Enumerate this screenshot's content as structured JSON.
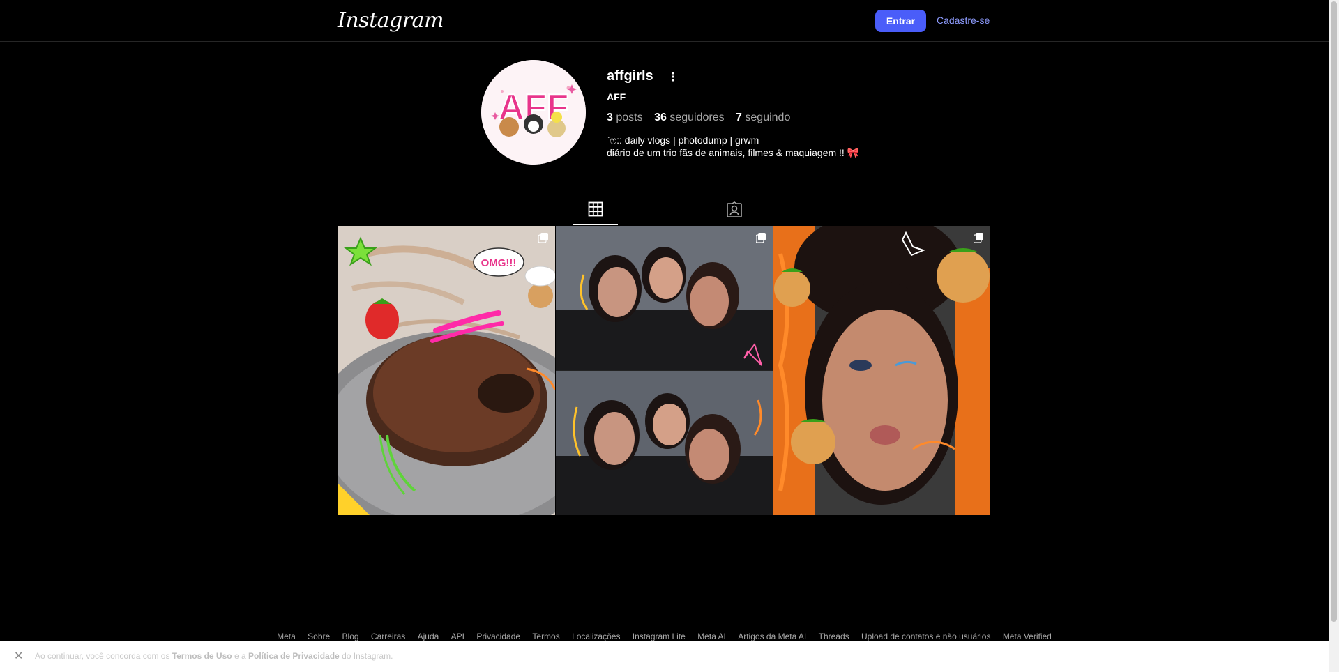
{
  "header": {
    "logo": "Instagram",
    "login_label": "Entrar",
    "signup_label": "Cadastre-se"
  },
  "profile": {
    "username": "affgirls",
    "full_name": "AFF",
    "avatar_text": "AFF",
    "stats": {
      "posts_count": "3",
      "posts_label": "posts",
      "followers_count": "36",
      "followers_label": "seguidores",
      "following_count": "7",
      "following_label": "seguindo"
    },
    "bio_line1": "`ෆ:: daily vlogs | photodump | grwm",
    "bio_line2": "diário de um trio fãs de animais, filmes & maquiagem !! 🎀"
  },
  "tabs": [
    {
      "icon": "grid-icon",
      "active": true
    },
    {
      "icon": "tagged-icon",
      "active": false
    }
  ],
  "posts": [
    {
      "subject": "chocolate cake",
      "sticker_text": "OMG!!!",
      "multi": true
    },
    {
      "subject": "three friends selfie",
      "multi": true
    },
    {
      "subject": "selfie with cats",
      "multi": true
    }
  ],
  "footer": {
    "links": [
      "Meta",
      "Sobre",
      "Blog",
      "Carreiras",
      "Ajuda",
      "API",
      "Privacidade",
      "Termos",
      "Localizações",
      "Instagram Lite",
      "Meta AI",
      "Artigos da Meta AI",
      "Threads",
      "Upload de contatos e não usuários",
      "Meta Verified"
    ]
  },
  "cookie": {
    "text_prefix": "Ao continuar, você concorda com os",
    "terms": "Termos de Uso",
    "and": "e a",
    "privacy": "Política de Privacidade",
    "suffix": "do Instagram."
  },
  "colors": {
    "background": "#000000",
    "primary_button": "#4a5df9",
    "link": "#8e9cff",
    "muted_text": "#a8a8a8"
  }
}
